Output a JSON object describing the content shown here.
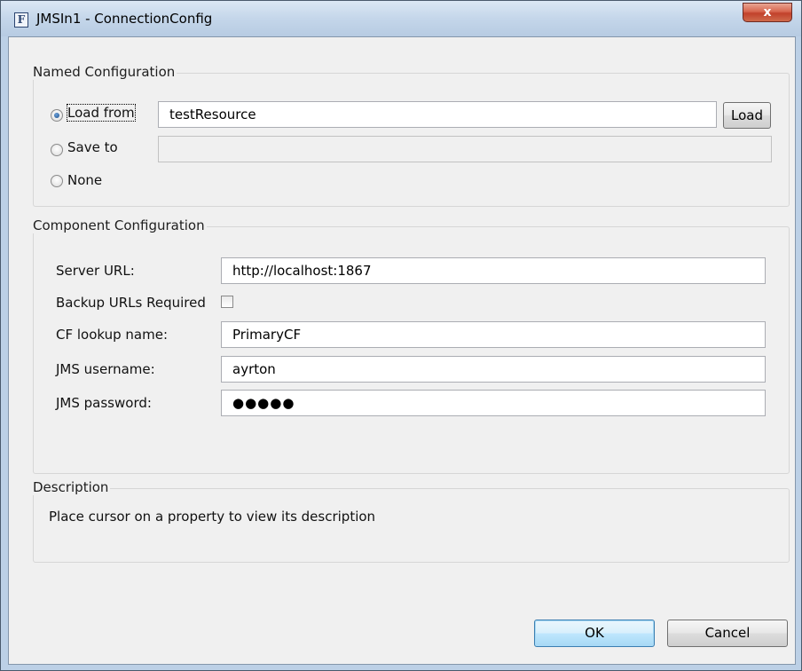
{
  "window": {
    "title": "JMSIn1 - ConnectionConfig",
    "app_icon_letter": "F",
    "close_glyph": "x"
  },
  "named_config": {
    "legend": "Named Configuration",
    "load_from_label": "Load from",
    "load_from_value": "testResource",
    "load_button": "Load",
    "save_to_label": "Save to",
    "save_to_value": "",
    "none_label": "None",
    "selected": "load_from"
  },
  "component_config": {
    "legend": "Component Configuration",
    "server_url_label": "Server URL:",
    "server_url_value": "http://localhost:1867",
    "backup_urls_label": "Backup URLs Required",
    "backup_urls_checked": false,
    "cf_lookup_label": "CF lookup name:",
    "cf_lookup_value": "PrimaryCF",
    "username_label": "JMS username:",
    "username_value": "ayrton",
    "password_label": "JMS password:",
    "password_value": "●●●●●"
  },
  "description": {
    "legend": "Description",
    "text": "Place cursor on a property to view its description"
  },
  "buttons": {
    "ok": "OK",
    "cancel": "Cancel"
  },
  "colors": {
    "title_bar": "#c4d6ea",
    "dialog_bg": "#f0f0f0",
    "close_button": "#c1412b",
    "default_button_border": "#3c7fb1"
  }
}
